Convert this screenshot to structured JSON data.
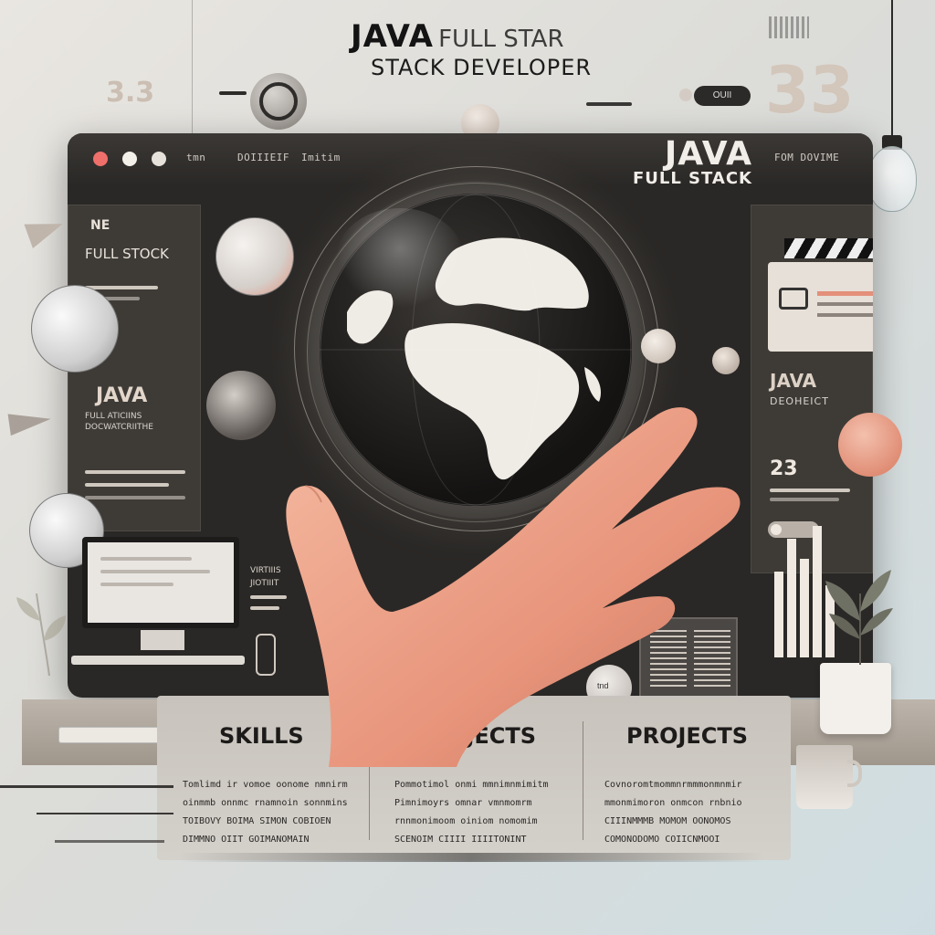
{
  "header": {
    "title_bold": "JAVA",
    "title_rest": "FULL STAR",
    "subtitle": "STACK DEVELOPER",
    "number_left": "3.3",
    "number_right": "33",
    "pill_label": "OUII"
  },
  "window": {
    "tabs": [
      "tmn",
      "DOIIIEIF",
      "Imitim"
    ],
    "tab_right": "FOM DOVIME",
    "brand_line1": "JAVA",
    "brand_line2": "FULL STACK"
  },
  "left_panel": {
    "tag": "NE",
    "heading": "FULL STOCK",
    "java_title": "JAVA",
    "java_sub1": "FULL ATICIINS",
    "java_sub2": "DOCWATCRIITHE"
  },
  "right_panel": {
    "java_title": "JAVA",
    "java_sub": "DEOHEICT",
    "number": "23"
  },
  "middle_labels": {
    "line1": "VIRTIIIS",
    "line2": "JIOTIIIT"
  },
  "book_label": "tnd",
  "sections": [
    {
      "title": "SKILLS",
      "body": "Tomlimd ir vomoe oonome nmnirm\noinmmb onnmc rnamnoin sonnmins\nTOIBOVY BOIMA SIMON COBIOEN\nDIMMNO OIIT GOIMANOMAIN"
    },
    {
      "title": "PROJECTS",
      "body": "Pommotimol onmi mmnimnmimitm\nPimnimoyrs omnar vmnmomrm\nrnnmonimoom oiniom nomomim\nSCENOIM CIIII IIIITONINT"
    },
    {
      "title": "PROJECTS",
      "body": "Covnoromtmommnrmmmonmnmir\nmmonmimoron onmcon rnbnio\nCIIINMMMB MOMOM OONOMOS\nCOMONODOMO COIICNMOOI"
    }
  ],
  "colors": {
    "window": "#2a2826",
    "light_red": "#ef6f6a",
    "light_1": "#f3efe9",
    "light_2": "#e6e1da",
    "accent_peach": "#e3907a",
    "background": "#e2e2de"
  },
  "chart_bars": [
    0.65,
    0.9,
    0.75,
    1.0,
    0.55
  ]
}
